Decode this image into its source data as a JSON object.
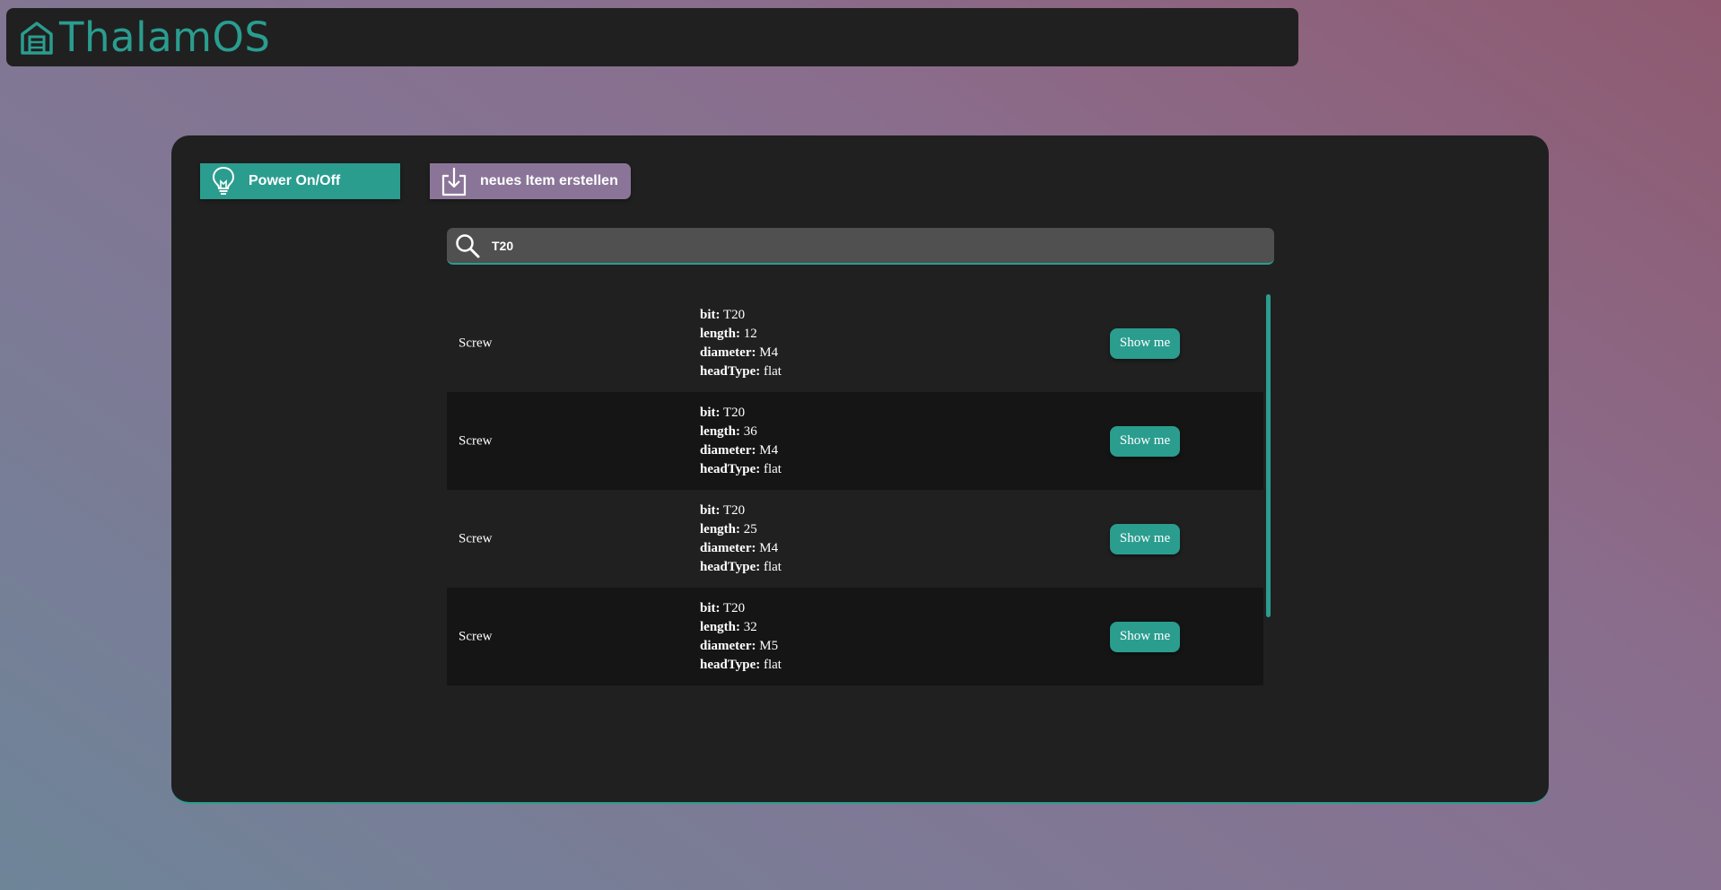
{
  "app": {
    "title": "ThalamOS",
    "icon": "warehouse-icon"
  },
  "toolbar": {
    "power_label": "Power On/Off",
    "power_icon": "lightbulb-icon",
    "new_item_label": "neues Item erstellen",
    "new_item_icon": "download-box-icon"
  },
  "search": {
    "value": "T20",
    "icon": "search-icon"
  },
  "results": [
    {
      "name": "Screw",
      "props": [
        [
          "bit",
          "T20"
        ],
        [
          "length",
          "12"
        ],
        [
          "diameter",
          "M4"
        ],
        [
          "headType",
          "flat"
        ]
      ],
      "button": "Show me"
    },
    {
      "name": "Screw",
      "props": [
        [
          "bit",
          "T20"
        ],
        [
          "length",
          "36"
        ],
        [
          "diameter",
          "M4"
        ],
        [
          "headType",
          "flat"
        ]
      ],
      "button": "Show me"
    },
    {
      "name": "Screw",
      "props": [
        [
          "bit",
          "T20"
        ],
        [
          "length",
          "25"
        ],
        [
          "diameter",
          "M4"
        ],
        [
          "headType",
          "flat"
        ]
      ],
      "button": "Show me"
    },
    {
      "name": "Screw",
      "props": [
        [
          "bit",
          "T20"
        ],
        [
          "length",
          "32"
        ],
        [
          "diameter",
          "M5"
        ],
        [
          "headType",
          "flat"
        ]
      ],
      "button": "Show me"
    }
  ],
  "colors": {
    "accent": "#2a9d8f",
    "secondary": "#8a7598",
    "panel": "#202020",
    "search_bg": "#505050"
  }
}
